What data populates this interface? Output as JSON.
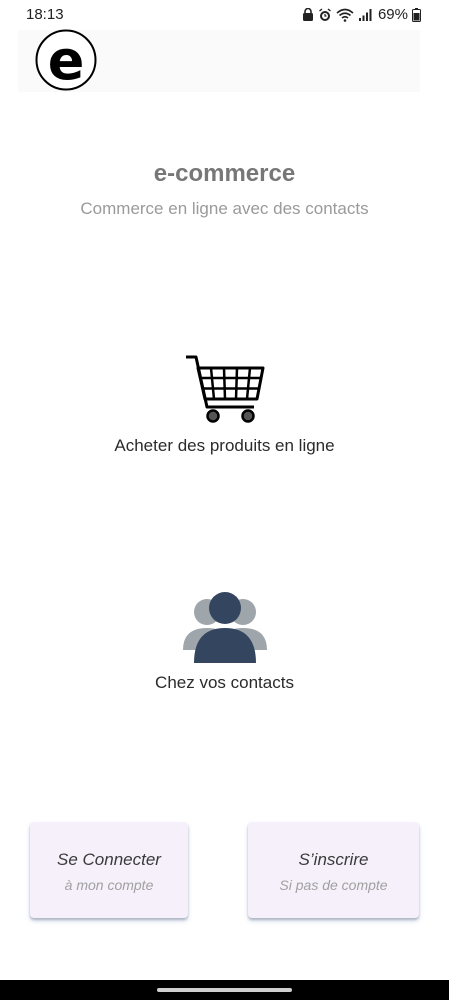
{
  "status_bar": {
    "time": "18:13",
    "battery": "69%",
    "icons": [
      "lock-icon",
      "alarm-icon",
      "wifi-icon",
      "signal-icon",
      "battery-icon"
    ]
  },
  "logo": {
    "icon": "e-logo-icon",
    "letter": "e"
  },
  "header": {
    "title": "e-commerce",
    "subtitle": "Commerce en ligne avec des contacts"
  },
  "features": [
    {
      "icon": "shopping-cart-icon",
      "label": "Acheter des produits en ligne"
    },
    {
      "icon": "contacts-icon",
      "label": "Chez vos contacts"
    }
  ],
  "actions": {
    "login": {
      "label": "Se Connecter",
      "sublabel": "à mon compte"
    },
    "signup": {
      "label": "S’inscrire",
      "sublabel": "Si pas de compte"
    }
  },
  "colors": {
    "title": "#777777",
    "subtitle": "#9a9a9a",
    "button_bg": "#f6f0fb",
    "contacts_front": "#34465f",
    "contacts_back": "#9ea5ab"
  }
}
